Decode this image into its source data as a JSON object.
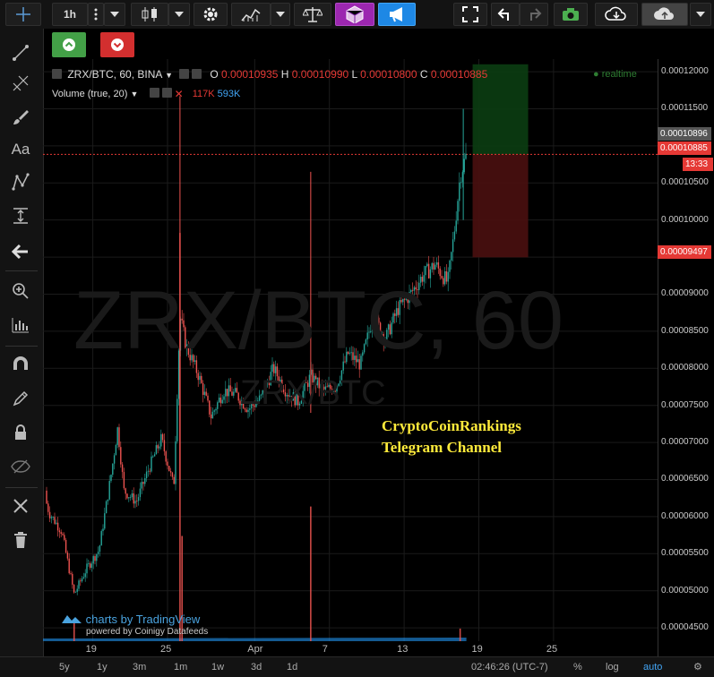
{
  "toolbar": {
    "interval": "1h"
  },
  "legend": {
    "symbol": "ZRX/BTC, 60, BINA",
    "open_label": "O",
    "open": "0.00010935",
    "high_label": "H",
    "high": "0.00010990",
    "low_label": "L",
    "low": "0.00010800",
    "close_label": "C",
    "close": "0.00010885",
    "volume_label": "Volume (true, 20)",
    "vol_a": "117K",
    "vol_b": "593K",
    "realtime": "realtime"
  },
  "watermark": {
    "big": "ZRX/BTC, 60",
    "small": "ZRX/BTC"
  },
  "annotation": {
    "line1": "CryptoCoinRankings",
    "line2": "Telegram Channel"
  },
  "branding": {
    "main": "charts by TradingView",
    "sub": "powered by Coinigy Datafeeds"
  },
  "price_tags": {
    "current_gray": "0.00010896",
    "current_red": "0.00010885",
    "countdown": "13:33",
    "stop": "0.00009497"
  },
  "bottom": {
    "ranges": [
      "5y",
      "1y",
      "3m",
      "1m",
      "1w",
      "3d",
      "1d"
    ],
    "clock": "02:46:26 (UTC-7)",
    "percent": "%",
    "log": "log",
    "auto": "auto"
  },
  "colors": {
    "up": "#26a69a",
    "down": "#ef5350",
    "accent": "#1e88e5",
    "annotation": "#ffeb3b"
  },
  "chart_data": {
    "type": "candlestick",
    "y_axis_labels": [
      "0.00012000",
      "0.00011500",
      "0.00011000",
      "0.00010500",
      "0.00010000",
      "0.00009500",
      "0.00009000",
      "0.00008500",
      "0.00008000",
      "0.00007500",
      "0.00007000",
      "0.00006500",
      "0.00006000",
      "0.00005500",
      "0.00005000",
      "0.00004500"
    ],
    "ylim": [
      4.32e-05,
      0.0001217
    ],
    "x_tick_labels": [
      "19",
      "25",
      "Apr",
      "7",
      "13",
      "19",
      "25"
    ],
    "x_range_days": [
      "2018-03-15",
      "2018-03-29"
    ],
    "price_trend": [
      {
        "day": "2018-03-15 00:00",
        "price": 6.35e-05
      },
      {
        "day": "2018-03-15 12:00",
        "price": 6.05e-05
      },
      {
        "day": "2018-03-16 12:00",
        "price": 5.8e-05
      },
      {
        "day": "2018-03-17 12:00",
        "price": 4.95e-05
      },
      {
        "day": "2018-03-18 12:00",
        "price": 5.3e-05
      },
      {
        "day": "2018-03-19 12:00",
        "price": 5.55e-05
      },
      {
        "day": "2018-03-20 12:00",
        "price": 6.6e-05
      },
      {
        "day": "2018-03-21 00:00",
        "price": 7.2e-05
      },
      {
        "day": "2018-03-21 12:00",
        "price": 6.35e-05
      },
      {
        "day": "2018-03-22 12:00",
        "price": 6.2e-05
      },
      {
        "day": "2018-03-23 12:00",
        "price": 6.65e-05
      },
      {
        "day": "2018-03-24 12:00",
        "price": 7.05e-05
      },
      {
        "day": "2018-03-25 12:00",
        "price": 6.4e-05
      },
      {
        "day": "2018-03-26 00:00",
        "price": 8.7e-05
      },
      {
        "day": "2018-03-26 12:00",
        "price": 8.3e-05
      },
      {
        "day": "2018-03-27 12:00",
        "price": 7.9e-05
      },
      {
        "day": "2018-03-28 12:00",
        "price": 7.35e-05
      },
      {
        "day": "2018-03-29 12:00",
        "price": 7.7e-05
      },
      {
        "day": "2018-03-30 12:00",
        "price": 7.65e-05
      },
      {
        "day": "2018-03-31 12:00",
        "price": 7.45e-05
      },
      {
        "day": "2018-04-01 12:00",
        "price": 7.6e-05
      },
      {
        "day": "2018-04-02 12:00",
        "price": 8e-05
      },
      {
        "day": "2018-04-03 12:00",
        "price": 7.7e-05
      },
      {
        "day": "2018-04-04 12:00",
        "price": 7.55e-05
      },
      {
        "day": "2018-04-05 12:00",
        "price": 7.9e-05
      },
      {
        "day": "2018-04-06 12:00",
        "price": 7.7e-05
      },
      {
        "day": "2018-04-07 12:00",
        "price": 7.75e-05
      },
      {
        "day": "2018-04-08 12:00",
        "price": 8.2e-05
      },
      {
        "day": "2018-04-09 12:00",
        "price": 8.05e-05
      },
      {
        "day": "2018-04-10 12:00",
        "price": 8.7e-05
      },
      {
        "day": "2018-04-11 12:00",
        "price": 8.4e-05
      },
      {
        "day": "2018-04-12 12:00",
        "price": 8.8e-05
      },
      {
        "day": "2018-04-13 12:00",
        "price": 9e-05
      },
      {
        "day": "2018-04-14 12:00",
        "price": 9.25e-05
      },
      {
        "day": "2018-04-15 12:00",
        "price": 9.4e-05
      },
      {
        "day": "2018-04-16 12:00",
        "price": 9.15e-05
      },
      {
        "day": "2018-04-17 00:00",
        "price": 9.8e-05
      },
      {
        "day": "2018-04-17 12:00",
        "price": 0.000106
      },
      {
        "day": "2018-04-18 00:00",
        "price": 0.0001088
      }
    ],
    "volume_spikes": [
      {
        "day": "2018-03-26 00:00",
        "rel": 0.97
      },
      {
        "day": "2018-04-05 12:00",
        "rel": 0.32
      },
      {
        "day": "2018-03-26 04:00",
        "rel": 0.25
      },
      {
        "day": "2018-03-17 12:00",
        "rel": 0.05
      },
      {
        "day": "2018-04-17 12:00",
        "rel": 0.03
      }
    ],
    "position": {
      "entry": 0.00010885,
      "target": 0.000121,
      "stop": 9.497e-05
    }
  }
}
